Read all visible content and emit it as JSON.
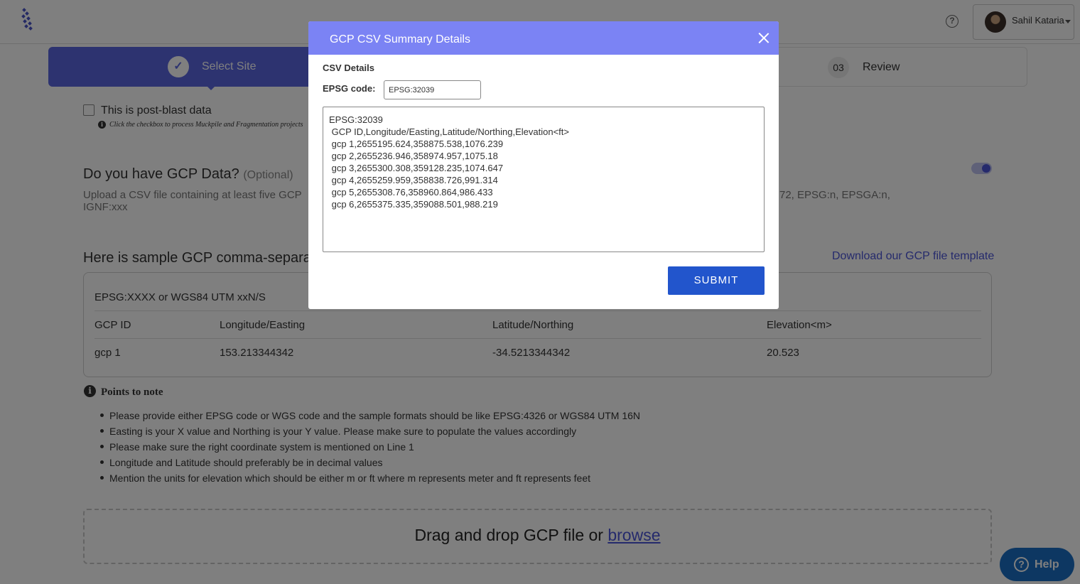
{
  "header": {
    "user_name": "Sahil Kataria",
    "help_icon_text": "?"
  },
  "stepper": {
    "active_step_label": "Select Site",
    "last_step_number": "03",
    "last_step_label": "Review"
  },
  "post_blast": {
    "label": "This is post-blast data",
    "hint": "Click the checkbox to process Muckpile and Fragmentation projects"
  },
  "gcp": {
    "title": "Do you have GCP Data?",
    "optional": "(Optional)",
    "desc_left": "Upload a CSV file containing at least five GCP IGNF:xxx",
    "desc_right": "72, EPSG:n, EPSGA:n,"
  },
  "sample": {
    "title": "Here is sample GCP comma-separate",
    "download_link": "Download our GCP file template",
    "header_line": "EPSG:XXXX or WGS84 UTM xxN/S",
    "columns": [
      "GCP ID",
      "Longitude/Easting",
      "Latitude/Northing",
      "Elevation<m>"
    ],
    "row": [
      "gcp 1",
      "153.213344342",
      "-34.5213344342",
      "20.523"
    ]
  },
  "points": {
    "title": "Points to note",
    "items": [
      "Please provide either EPSG code or WGS code and the sample formats should be like EPSG:4326 or WGS84 UTM 16N",
      "Easting is your X value and Northing is your Y value. Please make sure to populate the values accordingly",
      "Please make sure the right coordinate system is mentioned on Line 1",
      "Longitude and Latitude should preferably be in decimal values",
      "Mention the units for elevation which should be either m or ft where m represents meter and ft represents feet"
    ]
  },
  "dropzone": {
    "text": "Drag and drop GCP file or ",
    "browse": "browse"
  },
  "help_button": {
    "label": "Help"
  },
  "modal": {
    "title": "GCP CSV Summary Details",
    "section": "CSV Details",
    "epsg_label": "EPSG code:",
    "epsg_value": "EPSG:32039",
    "csv_content": "EPSG:32039\n GCP ID,Longitude/Easting,Latitude/Northing,Elevation<ft>\n gcp 1,2655195.624,358875.538,1076.239\n gcp 2,2655236.946,358974.957,1075.18\n gcp 3,2655300.308,359128.235,1074.647\n gcp 4,2655259.959,358838.726,991.314\n gcp 5,2655308.76,358960.864,986.433\n gcp 6,2655375.335,359088.501,988.219",
    "submit_label": "SUBMIT"
  },
  "colors": {
    "accent": "#5b66e0",
    "modal_header": "#7b83f4",
    "submit": "#2255cc",
    "help_button": "#1b6fc4"
  }
}
